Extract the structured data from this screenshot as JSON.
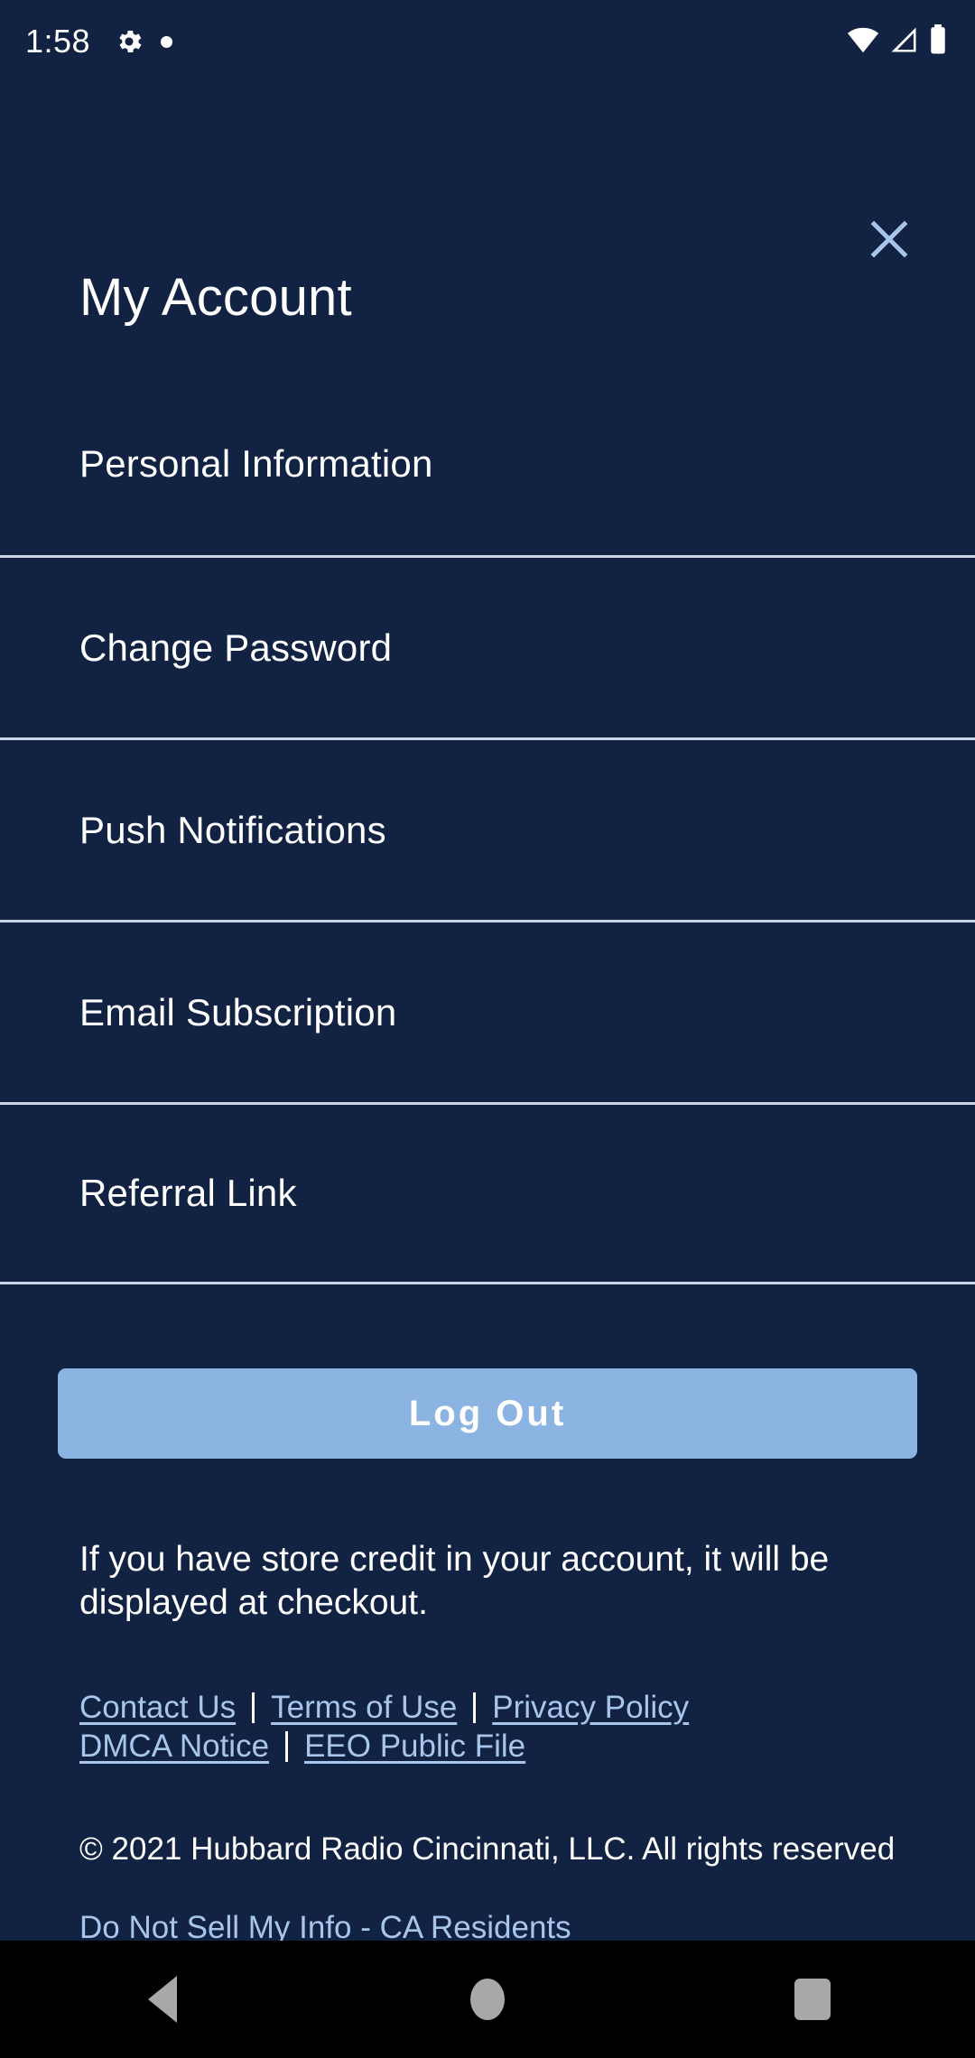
{
  "status_bar": {
    "time": "1:58",
    "icons": [
      "gear-icon",
      "dot-indicator",
      "wifi-icon",
      "cellular-signal-icon",
      "battery-icon"
    ]
  },
  "header": {
    "title": "My Account",
    "close_label": "×"
  },
  "menu": {
    "items": [
      {
        "label": "Personal Information"
      },
      {
        "label": "Change Password"
      },
      {
        "label": "Push Notifications"
      },
      {
        "label": "Email Subscription"
      },
      {
        "label": "Referral Link"
      }
    ]
  },
  "logout": {
    "label": "Log Out"
  },
  "credit_note": "If you have store credit in your account, it will be displayed at checkout.",
  "footer": {
    "row1": [
      {
        "label": "Contact Us"
      },
      {
        "label": "Terms of Use"
      },
      {
        "label": "Privacy Policy"
      }
    ],
    "row2": [
      {
        "label": "DMCA Notice"
      },
      {
        "label": "EEO Public File"
      }
    ],
    "copyright": "© 2021 Hubbard Radio Cincinnati, LLC. All rights reserved",
    "ca_link": "Do Not Sell My Info - CA Residents"
  },
  "nav_bar": {
    "back": "back-button",
    "home": "home-button",
    "recents": "recents-button"
  },
  "colors": {
    "background": "#112243",
    "accent": "#8cb4e3",
    "link": "#a8c6ec",
    "divider": "#c9d4e4",
    "text": "#ffffff"
  }
}
